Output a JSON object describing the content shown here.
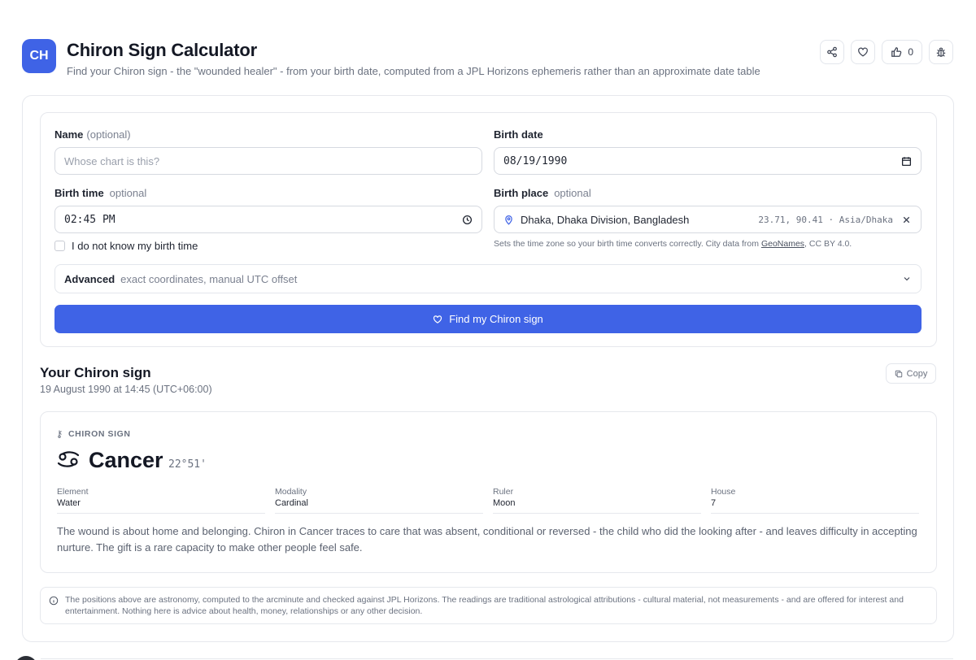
{
  "header": {
    "logo_text": "CH",
    "title": "Chiron Sign Calculator",
    "subtitle": "Find your Chiron sign - the \"wounded healer\" - from your birth date, computed from a JPL Horizons ephemeris rather than an approximate date table",
    "like_count": "0"
  },
  "form": {
    "name": {
      "label": "Name",
      "optional": "(optional)",
      "placeholder": "Whose chart is this?"
    },
    "birth_date": {
      "label": "Birth date",
      "value": "08/19/1990"
    },
    "birth_time": {
      "label": "Birth time",
      "optional": "optional",
      "value": "02:45 PM"
    },
    "birth_place": {
      "label": "Birth place",
      "optional": "optional",
      "value": "Dhaka, Dhaka Division, Bangladesh",
      "coords": "23.71, 90.41 · Asia/Dhaka",
      "hint_prefix": "Sets the time zone so your birth time converts correctly. City data from ",
      "hint_link": "GeoNames",
      "hint_suffix": ", CC BY 4.0."
    },
    "unknown_time_label": "I do not know my birth time",
    "advanced": {
      "label": "Advanced",
      "desc": "exact coordinates, manual UTC offset"
    },
    "submit_label": "Find my Chiron sign"
  },
  "result": {
    "title": "Your Chiron sign",
    "subtitle": "19 August 1990 at 14:45 (UTC+06:00)",
    "copy_label": "Copy",
    "eyebrow": "CHIRON SIGN",
    "sign": "Cancer",
    "degree": "22°51'",
    "attributes": [
      {
        "key": "Element",
        "value": "Water"
      },
      {
        "key": "Modality",
        "value": "Cardinal"
      },
      {
        "key": "Ruler",
        "value": "Moon"
      },
      {
        "key": "House",
        "value": "7"
      }
    ],
    "description": "The wound is about home and belonging. Chiron in Cancer traces to care that was absent, conditional or reversed - the child who did the looking after - and leaves difficulty in accepting nurture. The gift is a rare capacity to make other people feel safe."
  },
  "note": "The positions above are astronomy, computed to the arcminute and checked against JPL Horizons. The readings are traditional astrological attributions - cultural material, not measurements - and are offered for interest and entertainment. Nothing here is advice about health, money, relationships or any other decision.",
  "colors": {
    "accent": "#3f63e6",
    "text": "#1f2430",
    "muted": "#6b7280",
    "border": "#e6e8ed"
  },
  "icons": [
    "share-icon",
    "heart-icon",
    "thumbs-up-icon",
    "bug-icon",
    "calendar-icon",
    "clock-icon",
    "map-pin-icon",
    "close-icon",
    "chevron-down-icon",
    "heart-icon",
    "copy-icon",
    "chiron-glyph-icon",
    "cancer-glyph-icon",
    "info-icon"
  ]
}
